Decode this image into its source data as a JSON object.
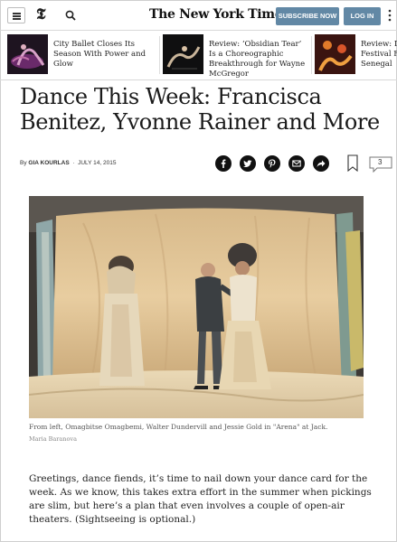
{
  "header": {
    "t_logo": "𝕿",
    "brand": "The New York Times",
    "subscribe_label": "SUBSCRIBE NOW",
    "login_label": "LOG IN"
  },
  "related": [
    {
      "title": "City Ballet Closes Its Season With Power and Glow"
    },
    {
      "title": "Review: ‘Obsidian Tear’ Is a Choreographic Breakthrough for Wayne McGregor"
    },
    {
      "title": "Review: D\nFestival F\nSenegal"
    }
  ],
  "article": {
    "headline": "Dance This Week: Francisca Benitez, Yvonne Rainer and More",
    "byline_prefix": "By",
    "author": "GIA KOURLAS",
    "date": "JULY 14, 2015",
    "comment_count": "3",
    "caption": "From left, Omagbitse Omagbemi, Walter Dundervill and Jessie Gold in \"Arena\" at Jack.",
    "credit": "Maria Baranova",
    "body": "Greetings, dance fiends, it’s time to nail down your dance card for the week. As we know, this takes extra effort in the summer when pickings are slim, but here’s a plan that even involves a couple of open-air theaters. (Sightseeing is optional.)"
  },
  "colors": {
    "accent_button": "#6288a5",
    "share_icon_bg": "#111111"
  }
}
